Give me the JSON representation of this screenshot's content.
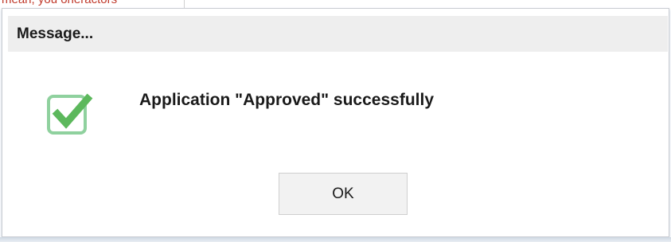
{
  "background": {
    "partial_text": "mean, you oneractors"
  },
  "dialog": {
    "title": "Message...",
    "icon": "checkbox-checked-icon",
    "message": "Application \"Approved\" successfully",
    "ok_label": "OK"
  },
  "colors": {
    "title_bar_bg": "#eeeeee",
    "icon_green": "#5cb85c",
    "background_text_red": "#c0392b",
    "button_bg": "#f2f2f2"
  }
}
